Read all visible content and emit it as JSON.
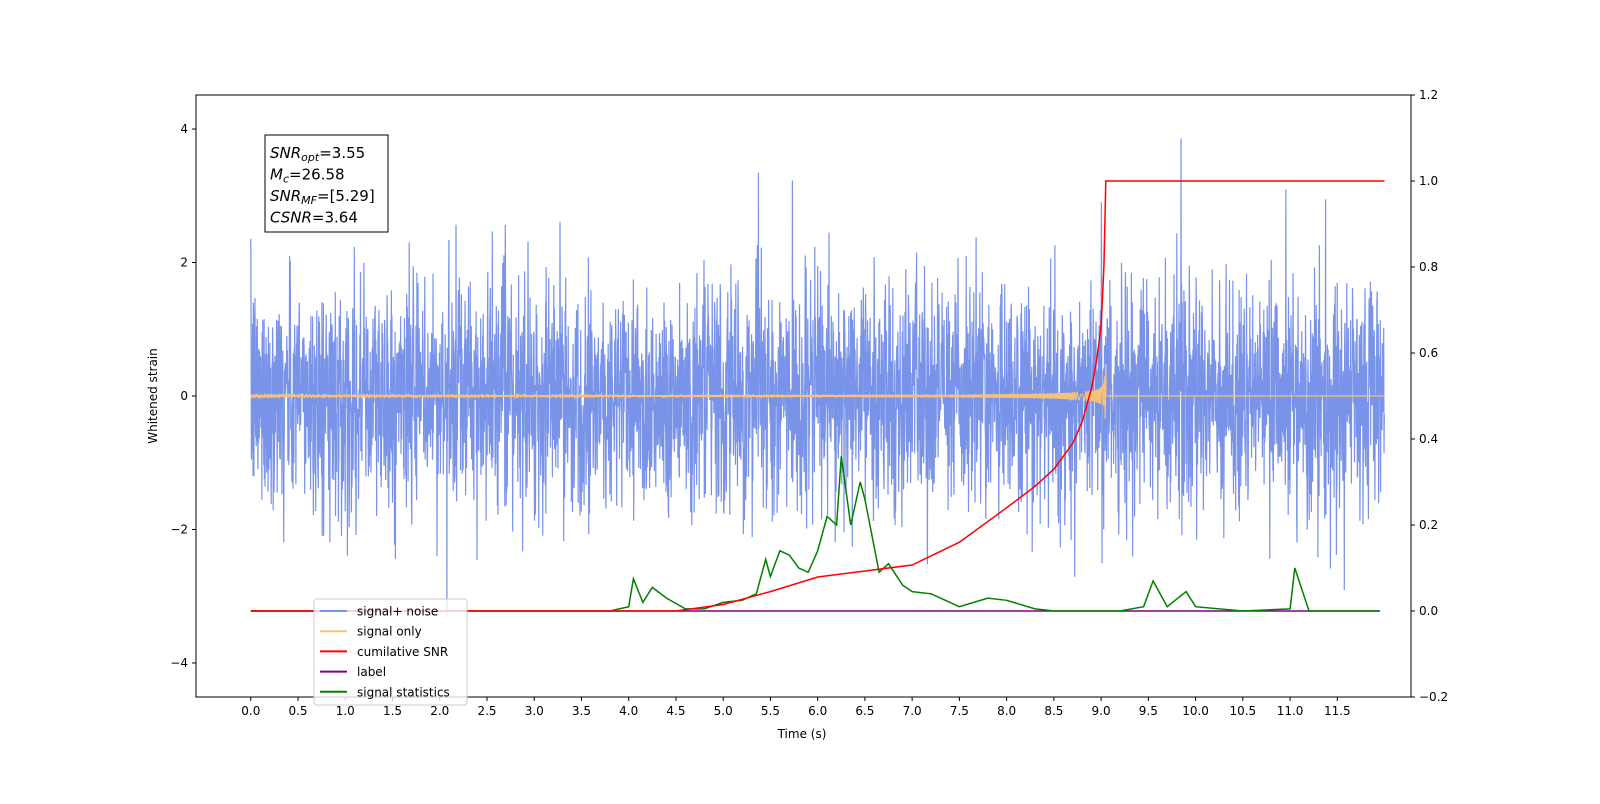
{
  "chart_data": {
    "type": "line",
    "xlabel": "Time (s)",
    "ylabel": "Whitened strain",
    "xlim": [
      -0.58,
      12.28
    ],
    "ylim": [
      -4.51,
      4.51
    ],
    "ylim_right": [
      -0.2,
      1.2
    ],
    "x_ticks": [
      "0.0",
      "0.5",
      "1.0",
      "1.5",
      "2.0",
      "2.5",
      "3.0",
      "3.5",
      "4.0",
      "4.5",
      "5.0",
      "5.5",
      "6.0",
      "6.5",
      "7.0",
      "7.5",
      "8.0",
      "8.5",
      "9.0",
      "9.5",
      "10.0",
      "10.5",
      "11.0",
      "11.5"
    ],
    "y_ticks": [
      "4",
      "2",
      "0",
      "−2",
      "−4"
    ],
    "y_ticks_right": [
      "1.2",
      "1.0",
      "0.8",
      "0.6",
      "0.4",
      "0.2",
      "0.0",
      "−0.2"
    ],
    "grid": false,
    "legend_placement": "lower-left",
    "annotation": {
      "lines": [
        {
          "base": "SNR",
          "sub": "opt",
          "rest": "=3.55"
        },
        {
          "base": "M",
          "sub": "c",
          "rest": "=26.58"
        },
        {
          "base": "SNR",
          "sub": "MF",
          "rest": "=[5.29]"
        },
        {
          "base": "CSNR",
          "sub": "",
          "rest": "=3.64"
        }
      ]
    },
    "series": [
      {
        "name": "signal+ noise",
        "color": "#7893e8",
        "axis": "left",
        "description_values": "noise amplitude about ±2.5, spikes to about ±4"
      },
      {
        "name": "signal only",
        "color": "#f5c27a",
        "axis": "left",
        "merger_time": 9.05,
        "peak_amplitude": 0.9
      },
      {
        "name": "cumilative SNR",
        "color": "#ff0000",
        "axis": "right",
        "x": [
          0,
          4.5,
          5.0,
          5.5,
          6.0,
          6.5,
          7.0,
          7.5,
          8.0,
          8.3,
          8.5,
          8.7,
          8.8,
          8.9,
          8.95,
          9.0,
          9.03,
          9.05,
          9.06,
          12.0
        ],
        "y": [
          0,
          0,
          0.015,
          0.045,
          0.079,
          0.093,
          0.107,
          0.16,
          0.24,
          0.29,
          0.33,
          0.39,
          0.44,
          0.52,
          0.58,
          0.66,
          0.8,
          1.0,
          1.0,
          1.0
        ]
      },
      {
        "name": "label",
        "color": "#800080",
        "axis": "right",
        "x": [
          0,
          11.95
        ],
        "y": [
          0,
          0
        ]
      },
      {
        "name": "signal statistics",
        "color": "#008000",
        "axis": "right",
        "x": [
          0,
          3.8,
          4.0,
          4.05,
          4.15,
          4.25,
          4.4,
          4.6,
          4.8,
          5.0,
          5.2,
          5.35,
          5.45,
          5.5,
          5.6,
          5.7,
          5.8,
          5.9,
          6.0,
          6.1,
          6.2,
          6.25,
          6.35,
          6.45,
          6.5,
          6.65,
          6.75,
          6.9,
          7.0,
          7.2,
          7.5,
          7.8,
          8.0,
          8.3,
          8.5,
          9.2,
          9.45,
          9.55,
          9.7,
          9.9,
          10.0,
          10.5,
          11.0,
          11.05,
          11.2,
          11.95
        ],
        "y": [
          0,
          0,
          0.01,
          0.075,
          0.02,
          0.055,
          0.03,
          0.005,
          0.005,
          0.02,
          0.025,
          0.04,
          0.12,
          0.08,
          0.14,
          0.13,
          0.1,
          0.09,
          0.14,
          0.22,
          0.2,
          0.36,
          0.2,
          0.3,
          0.26,
          0.09,
          0.11,
          0.06,
          0.045,
          0.04,
          0.01,
          0.03,
          0.025,
          0.005,
          0,
          0,
          0.01,
          0.07,
          0.01,
          0.045,
          0.01,
          0,
          0.005,
          0.1,
          0,
          0
        ]
      }
    ]
  }
}
